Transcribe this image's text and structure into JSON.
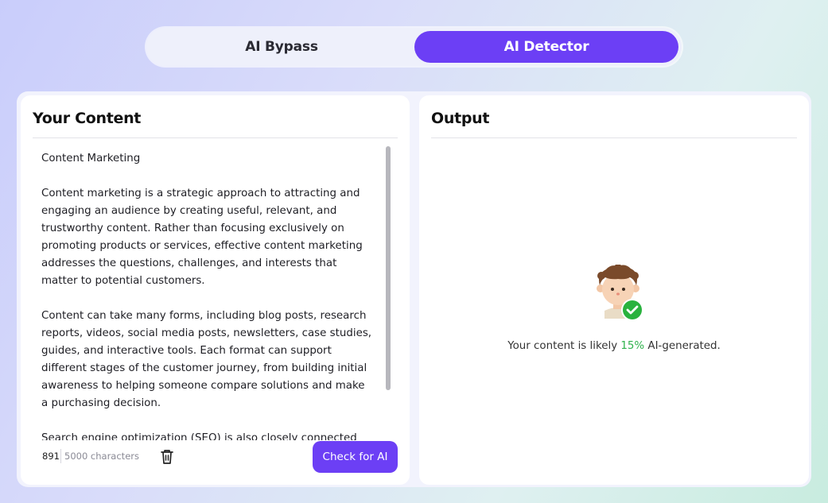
{
  "toggle": {
    "option_bypass": "AI Bypass",
    "option_detector": "AI Detector",
    "active": "AI Detector"
  },
  "input_panel": {
    "title": "Your Content",
    "text": "Content Marketing\n\nContent marketing is a strategic approach to attracting and engaging an audience by creating useful, relevant, and trustworthy content. Rather than focusing exclusively on promoting products or services, effective content marketing addresses the questions, challenges, and interests that matter to potential customers.\n\nContent can take many forms, including blog posts, research reports, videos, social media posts, newsletters, case studies, guides, and interactive tools. Each format can support different stages of the customer journey, from building initial awareness to helping someone compare solutions and make a purchasing decision.\n\nSearch engine optimization (SEO) is also closely connected",
    "char_count": "891",
    "char_limit": "5000 characters",
    "check_button": "Check for AI"
  },
  "output_panel": {
    "title": "Output",
    "result_prefix": "Your content is likely ",
    "result_percent": "15%",
    "result_suffix": " AI-generated."
  },
  "colors": {
    "accent": "#6c3ff5",
    "success": "#2fb24c"
  },
  "icons": {
    "delete": "trash-icon",
    "result": "avatar-check-icon"
  }
}
